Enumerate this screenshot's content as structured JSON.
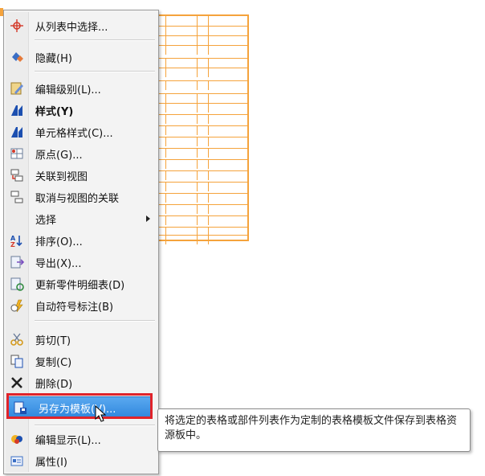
{
  "menu": {
    "items": [
      {
        "label": "从列表中选择...",
        "icon": "crosshair-icon"
      },
      {
        "label": "隐藏(H)",
        "icon": "hide-icon"
      },
      {
        "label": "编辑级别(L)...",
        "icon": "edit-level-icon"
      },
      {
        "label": "样式(Y)",
        "icon": "style-icon",
        "bold": true
      },
      {
        "label": "单元格样式(C)...",
        "icon": "cell-style-icon"
      },
      {
        "label": "原点(G)...",
        "icon": "origin-icon"
      },
      {
        "label": "关联到视图",
        "icon": "link-view-icon"
      },
      {
        "label": "取消与视图的关联",
        "icon": "unlink-view-icon"
      },
      {
        "label": "选择",
        "icon": "none",
        "submenu": true
      },
      {
        "label": "排序(O)...",
        "icon": "sort-icon"
      },
      {
        "label": "导出(X)...",
        "icon": "export-icon"
      },
      {
        "label": "更新零件明细表(D)",
        "icon": "update-bom-icon"
      },
      {
        "label": "自动符号标注(B)",
        "icon": "auto-balloon-icon"
      },
      {
        "label": "剪切(T)",
        "icon": "cut-icon"
      },
      {
        "label": "复制(C)",
        "icon": "copy-icon"
      },
      {
        "label": "删除(D)",
        "icon": "delete-icon"
      },
      {
        "label": "另存为模板(V)...",
        "icon": "save-template-icon",
        "highlighted": true
      },
      {
        "label": "编辑显示(L)...",
        "icon": "edit-display-icon"
      },
      {
        "label": "属性(I)",
        "icon": "properties-icon"
      }
    ]
  },
  "tooltip": {
    "text": "将选定的表格或部件列表作为定制的表格模板文件保存到表格资源板中。"
  },
  "colors": {
    "highlight": "#3d92e4",
    "highlight_frame": "#e0232a",
    "table_stroke": "#f5a33c"
  }
}
